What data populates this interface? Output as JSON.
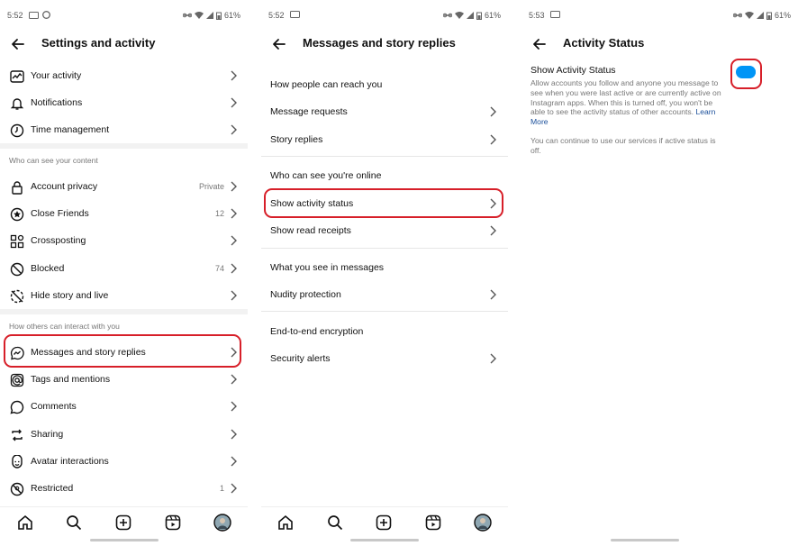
{
  "panel1": {
    "status": {
      "time": "5:52",
      "battery": "61%"
    },
    "title": "Settings and activity",
    "items_a": [
      {
        "label": "Your activity",
        "icon": "activity-icon"
      },
      {
        "label": "Notifications",
        "icon": "bell-icon"
      },
      {
        "label": "Time management",
        "icon": "clock-icon"
      }
    ],
    "section_content": "Who can see your content",
    "items_b": [
      {
        "label": "Account privacy",
        "value": "Private",
        "icon": "lock-icon"
      },
      {
        "label": "Close Friends",
        "value": "12",
        "icon": "star-circle-icon"
      },
      {
        "label": "Crossposting",
        "value": "",
        "icon": "grid-icon"
      },
      {
        "label": "Blocked",
        "value": "74",
        "icon": "blocked-icon"
      },
      {
        "label": "Hide story and live",
        "value": "",
        "icon": "hide-story-icon"
      }
    ],
    "section_interact": "How others can interact with you",
    "items_c": [
      {
        "label": "Messages and story replies",
        "value": "",
        "icon": "messenger-icon"
      },
      {
        "label": "Tags and mentions",
        "value": "",
        "icon": "at-icon"
      },
      {
        "label": "Comments",
        "value": "",
        "icon": "comment-icon"
      },
      {
        "label": "Sharing",
        "value": "",
        "icon": "share-icon"
      },
      {
        "label": "Avatar interactions",
        "value": "",
        "icon": "avatar-face-icon"
      },
      {
        "label": "Restricted",
        "value": "1",
        "icon": "restricted-icon"
      }
    ]
  },
  "panel2": {
    "status": {
      "time": "5:52",
      "battery": "61%"
    },
    "title": "Messages and story replies",
    "section_reach": "How people can reach you",
    "message_requests": "Message requests",
    "story_replies": "Story replies",
    "section_online": "Who can see you're online",
    "show_activity_status": "Show activity status",
    "show_read_receipts": "Show read receipts",
    "section_see": "What you see in messages",
    "nudity_protection": "Nudity protection",
    "section_e2e": "End-to-end encryption",
    "security_alerts": "Security alerts"
  },
  "panel3": {
    "status": {
      "time": "5:53",
      "battery": "61%"
    },
    "title": "Activity Status",
    "setting_title": "Show Activity Status",
    "description": "Allow accounts you follow and anyone you message to see when you were last active or are currently active on Instagram apps. When this is turned off, you won't be able to see the activity status of other accounts.",
    "learn_more": "Learn More",
    "note": "You can continue to use our services if active status is off.",
    "toggle_on": true
  },
  "colors": {
    "accent": "#0095f6",
    "highlight": "#d71f29",
    "link": "#1a4f9a"
  }
}
